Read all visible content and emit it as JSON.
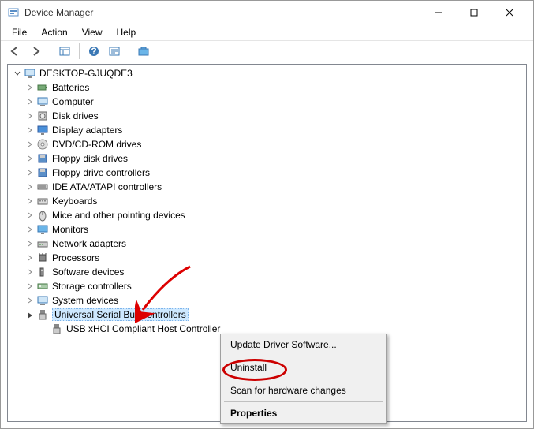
{
  "window": {
    "title": "Device Manager",
    "controls": {
      "minimize": "–",
      "maximize": "☐",
      "close": "✕"
    }
  },
  "menubar": {
    "file": "File",
    "action": "Action",
    "view": "View",
    "help": "Help"
  },
  "toolbar": {
    "back": "back",
    "forward": "forward",
    "details": "details",
    "help": "help",
    "properties": "properties",
    "scan": "scan"
  },
  "tree": {
    "root": "DESKTOP-GJUQDE3",
    "items": [
      {
        "label": "Batteries",
        "icon": "battery"
      },
      {
        "label": "Computer",
        "icon": "computer"
      },
      {
        "label": "Disk drives",
        "icon": "disk"
      },
      {
        "label": "Display adapters",
        "icon": "display"
      },
      {
        "label": "DVD/CD-ROM drives",
        "icon": "dvd"
      },
      {
        "label": "Floppy disk drives",
        "icon": "floppy"
      },
      {
        "label": "Floppy drive controllers",
        "icon": "floppy-ctrl"
      },
      {
        "label": "IDE ATA/ATAPI controllers",
        "icon": "ide"
      },
      {
        "label": "Keyboards",
        "icon": "keyboard"
      },
      {
        "label": "Mice and other pointing devices",
        "icon": "mouse"
      },
      {
        "label": "Monitors",
        "icon": "monitor"
      },
      {
        "label": "Network adapters",
        "icon": "network"
      },
      {
        "label": "Processors",
        "icon": "processor"
      },
      {
        "label": "Software devices",
        "icon": "software"
      },
      {
        "label": "Storage controllers",
        "icon": "storage"
      },
      {
        "label": "System devices",
        "icon": "system"
      },
      {
        "label": "Universal Serial Bus controllers",
        "icon": "usb",
        "selected": true,
        "expanded": true
      }
    ],
    "usb_child": "USB xHCI Compliant Host Controller"
  },
  "context_menu": {
    "update": "Update Driver Software...",
    "uninstall": "Uninstall",
    "scan": "Scan for hardware changes",
    "properties": "Properties"
  }
}
